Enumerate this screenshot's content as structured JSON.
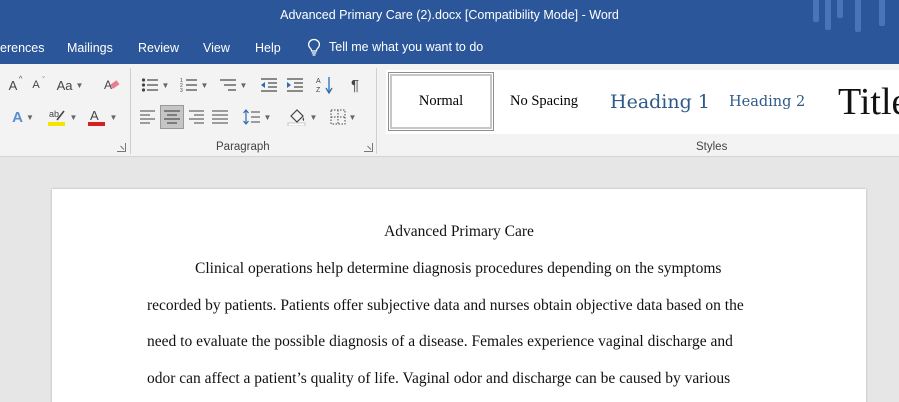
{
  "window": {
    "title": "Advanced Primary Care (2).docx [Compatibility Mode]  -  Word"
  },
  "tabs": [
    {
      "label": "erences"
    },
    {
      "label": "Mailings"
    },
    {
      "label": "Review"
    },
    {
      "label": "View"
    },
    {
      "label": "Help"
    }
  ],
  "tell_me": {
    "label": "Tell me what you want to do"
  },
  "ribbon": {
    "font_group": {
      "grow_label": "A",
      "shrink_label": "A",
      "case_label": "Aa",
      "font_color_label": "A",
      "highlight_color": "#f5e400",
      "font_color": "#d62020"
    },
    "paragraph_group": {
      "label": "Paragraph"
    },
    "styles_group": {
      "label": "Styles"
    }
  },
  "styles": [
    {
      "label": "Normal"
    },
    {
      "label": "No Spacing"
    },
    {
      "label": "Heading 1"
    },
    {
      "label": "Heading 2"
    },
    {
      "label": "Title"
    }
  ],
  "document": {
    "title": "Advanced Primary Care",
    "lines": [
      "Clinical operations help determine diagnosis procedures depending on the symptoms",
      "recorded by patients. Patients offer subjective data and nurses obtain objective data based on the",
      "need to evaluate the possible diagnosis of a disease. Females experience vaginal discharge and",
      "odor can affect a patient’s quality of life. Vaginal odor and discharge can be caused by various"
    ]
  },
  "colors": {
    "brand": "#2b579a",
    "ribbon_bg": "#f3f3f3",
    "heading_blue": "#2e5a8a"
  }
}
